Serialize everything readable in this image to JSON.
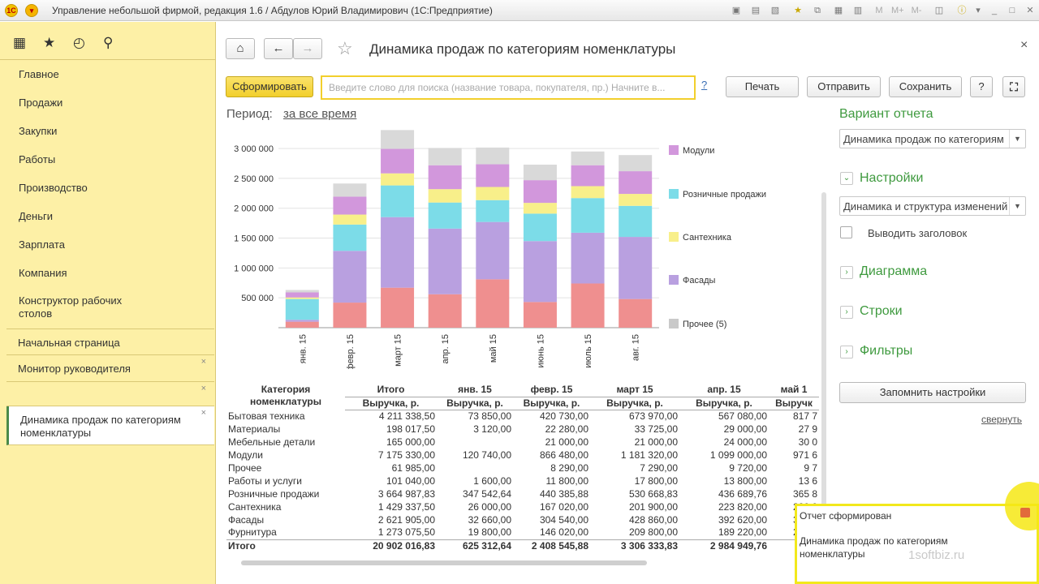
{
  "window": {
    "title": "Управление небольшой фирмой, редакция 1.6 / Абдулов Юрий Владимирович (1С:Предприятие)"
  },
  "sidebar": {
    "nav": [
      "Главное",
      "Продажи",
      "Закупки",
      "Работы",
      "Производство",
      "Деньги",
      "Зарплата",
      "Компания",
      "Конструктор рабочих столов"
    ],
    "open_windows": [
      {
        "label": "Начальная страница",
        "closable": false,
        "active": false
      },
      {
        "label": "Монитор руководителя",
        "closable": true,
        "active": false
      },
      {
        "label": "",
        "closable": true,
        "active": false
      },
      {
        "label": "Динамика продаж по категориям номенклатуры",
        "closable": true,
        "active": true
      }
    ]
  },
  "header": {
    "title": "Динамика продаж по категориям номенклатуры",
    "close": "×"
  },
  "toolbar": {
    "generate": "Сформировать",
    "search_placeholder": "Введите слово для поиска (название товара, покупателя, пр.) Начните в...",
    "help_q": "?",
    "print": "Печать",
    "send": "Отправить",
    "save": "Сохранить",
    "help": "?"
  },
  "period": {
    "label": "Период:",
    "value": "за все время"
  },
  "chart_data": {
    "type": "bar",
    "stacked": true,
    "categories": [
      "янв. 15",
      "февр. 15",
      "март 15",
      "апр. 15",
      "май 15",
      "июнь 15",
      "июль 15",
      "авг. 15"
    ],
    "y_ticks": [
      "500 000",
      "1 000 000",
      "1 500 000",
      "2 000 000",
      "2 500 000",
      "3 000 000"
    ],
    "ylim": [
      0,
      3300000
    ],
    "series": [
      {
        "name": "Прочее (5)",
        "color": "#ef8f8f",
        "values": [
          100000,
          420000,
          670000,
          560000,
          810000,
          430000,
          740000,
          480000
        ]
      },
      {
        "name": "Фасады",
        "color": "#b9a0e0",
        "values": [
          32660,
          866480,
          1181320,
          1099000,
          960000,
          1020000,
          850000,
          1040000
        ]
      },
      {
        "name": "Сантехника",
        "color": "#7cdce8",
        "values": [
          347543,
          440386,
          530669,
          436690,
          366000,
          460000,
          580000,
          520000
        ]
      },
      {
        "name": "Розничные продажи",
        "color": "#f8ef8a",
        "values": [
          26000,
          167020,
          201900,
          223820,
          220000,
          180000,
          200000,
          200000
        ]
      },
      {
        "name": "Модули",
        "color": "#d297dc",
        "values": [
          85000,
          300000,
          410000,
          400000,
          380000,
          380000,
          350000,
          380000
        ]
      },
      {
        "name": "",
        "color": "#d9d9d9",
        "values": [
          40000,
          220000,
          315000,
          290000,
          280000,
          260000,
          230000,
          270000
        ]
      }
    ],
    "legend": [
      "Модули",
      "Розничные продажи",
      "Сантехника",
      "Фасады",
      "Прочее (5)"
    ],
    "legend_colors": [
      "#d297dc",
      "#7cdce8",
      "#f8ef8a",
      "#b9a0e0",
      "#c9c9c9"
    ],
    "legend_position": "right"
  },
  "table": {
    "header1": [
      "Категория номенклатуры",
      "Итого",
      "янв. 15",
      "февр. 15",
      "март 15",
      "апр. 15",
      "май 1"
    ],
    "header2": [
      "",
      "Выручка, р.",
      "Выручка, р.",
      "Выручка, р.",
      "Выручка, р.",
      "Выручка, р.",
      "Выручк"
    ],
    "rows": [
      [
        "Бытовая техника",
        "4 211 338,50",
        "73 850,00",
        "420 730,00",
        "673 970,00",
        "567 080,00",
        "817 7"
      ],
      [
        "Материалы",
        "198 017,50",
        "3 120,00",
        "22 280,00",
        "33 725,00",
        "29 000,00",
        "27 9"
      ],
      [
        "Мебельные детали",
        "165 000,00",
        "",
        "21 000,00",
        "21 000,00",
        "24 000,00",
        "30 0"
      ],
      [
        "Модули",
        "7 175 330,00",
        "120 740,00",
        "866 480,00",
        "1 181 320,00",
        "1 099 000,00",
        "971 6"
      ],
      [
        "Прочее",
        "61 985,00",
        "",
        "8 290,00",
        "7 290,00",
        "9 720,00",
        "9 7"
      ],
      [
        "Работы и услуги",
        "101 040,00",
        "1 600,00",
        "11 800,00",
        "17 800,00",
        "13 800,00",
        "13 6"
      ],
      [
        "Розничные продажи",
        "3 664 987,83",
        "347 542,64",
        "440 385,88",
        "530 668,83",
        "436 689,76",
        "365 8"
      ],
      [
        "Сантехника",
        "1 429 337,50",
        "26 000,00",
        "167 020,00",
        "201 900,00",
        "223 820,00",
        "220 0"
      ],
      [
        "Фасады",
        "2 621 905,00",
        "32 660,00",
        "304 540,00",
        "428 860,00",
        "392 620,00",
        "380 7"
      ],
      [
        "Фурнитура",
        "1 273 075,50",
        "19 800,00",
        "146 020,00",
        "209 800,00",
        "189 220,00",
        "220 0"
      ]
    ],
    "total": [
      "Итого",
      "20 902 016,83",
      "625 312,64",
      "2 408 545,88",
      "3 306 333,83",
      "2 984 949,76",
      "3 0"
    ]
  },
  "right_panel": {
    "variant_title": "Вариант отчета",
    "variant_value": "Динамика продаж по категориям",
    "settings_title": "Настройки",
    "settings_value": "Динамика и структура изменений",
    "show_header": "Выводить заголовок",
    "diagram": "Диаграмма",
    "rows": "Строки",
    "filters": "Фильтры",
    "remember": "Запомнить настройки",
    "collapse": "свернуть"
  },
  "toast": {
    "title": "Отчет сформирован",
    "text": "Динамика продаж по категориям номенклатуры",
    "watermark": "1softbiz.ru"
  }
}
